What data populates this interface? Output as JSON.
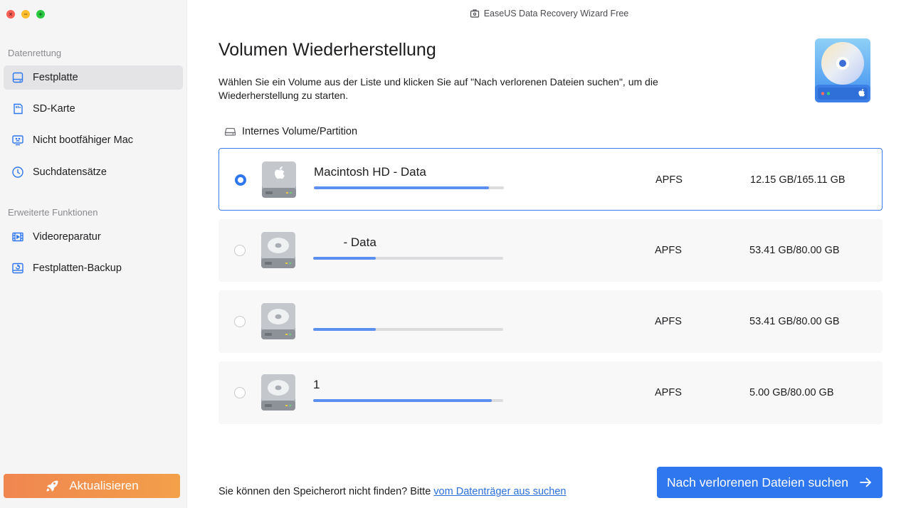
{
  "window": {
    "title": "EaseUS Data Recovery Wizard  Free"
  },
  "sidebar": {
    "sections": [
      {
        "title": "Datenrettung",
        "items": [
          {
            "label": "Festplatte",
            "icon": "hard-drive-icon",
            "active": true
          },
          {
            "label": "SD-Karte",
            "icon": "sd-card-icon",
            "active": false
          },
          {
            "label": "Nicht bootfähiger Mac",
            "icon": "monitor-icon",
            "active": false
          },
          {
            "label": "Suchdatensätze",
            "icon": "clock-icon",
            "active": false
          }
        ]
      },
      {
        "title": "Erweiterte Funktionen",
        "items": [
          {
            "label": "Videoreparatur",
            "icon": "film-icon",
            "active": false
          },
          {
            "label": "Festplatten-Backup",
            "icon": "backup-icon",
            "active": false
          }
        ]
      }
    ],
    "update_button": "Aktualisieren"
  },
  "main": {
    "title": "Volumen Wiederherstellung",
    "description": "Wählen Sie ein Volume aus der Liste und klicken Sie auf \"Nach verlorenen Dateien suchen\", um die Wiederherstellung zu starten.",
    "group_label": "Internes Volume/Partition",
    "volumes": [
      {
        "name": "Macintosh HD - Data",
        "fs": "APFS",
        "size": "12.15 GB/165.11 GB",
        "usage": 0.92,
        "selected": true,
        "disk_icon": "apple-disk-icon"
      },
      {
        "name": "         - Data",
        "fs": "APFS",
        "size": "53.41 GB/80.00 GB",
        "usage": 0.33,
        "selected": false,
        "disk_icon": "disk-icon"
      },
      {
        "name": "",
        "fs": "APFS",
        "size": "53.41 GB/80.00 GB",
        "usage": 0.33,
        "selected": false,
        "disk_icon": "disk-icon"
      },
      {
        "name": "1",
        "fs": "APFS",
        "size": "5.00 GB/80.00 GB",
        "usage": 0.94,
        "selected": false,
        "disk_icon": "disk-icon"
      }
    ]
  },
  "footer": {
    "text": "Sie können den Speicherort nicht finden? Bitte ",
    "link": "vom Datenträger aus suchen",
    "primary_button": "Nach verlorenen Dateien suchen"
  },
  "colors": {
    "accent": "#2f77ee",
    "update_gradient_start": "#f08650",
    "update_gradient_end": "#f3a04a",
    "usage_bar": "#5b8ff0"
  }
}
